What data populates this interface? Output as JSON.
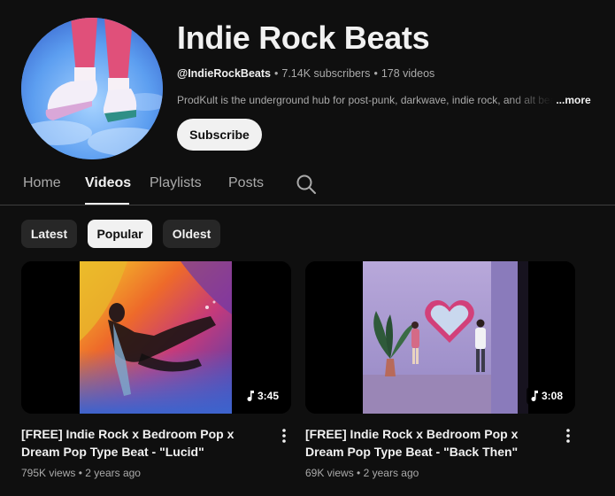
{
  "channel": {
    "title": "Indie Rock Beats",
    "handle": "@IndieRockBeats",
    "subscribers": "7.14K subscribers",
    "video_count": "178 videos",
    "description": "ProdKult is the underground hub for post-punk, darkwave, indie rock, and alt beats",
    "more_label": "...more",
    "subscribe_label": "Subscribe"
  },
  "tabs": [
    {
      "label": "Home"
    },
    {
      "label": "Videos",
      "active": true
    },
    {
      "label": "Playlists"
    },
    {
      "label": "Posts"
    }
  ],
  "filters": [
    {
      "label": "Latest"
    },
    {
      "label": "Popular",
      "active": true
    },
    {
      "label": "Oldest"
    }
  ],
  "videos": [
    {
      "title": "[FREE] Indie Rock x Bedroom Pop x Dream Pop Type Beat - \"Lucid\"",
      "duration": "3:45",
      "views": "795K views",
      "age": "2 years ago"
    },
    {
      "title": "[FREE] Indie Rock x Bedroom Pop x Dream Pop Type Beat - \"Back Then\"",
      "duration": "3:08",
      "views": "69K views",
      "age": "2 years ago"
    }
  ],
  "meta_separator": "•",
  "icons": {
    "search": "search-icon",
    "music_note": "music-note-icon",
    "more_vert": "more-vert-icon"
  },
  "colors": {
    "background": "#0f0f0f",
    "text_primary": "#f1f1f1",
    "text_secondary": "#aaaaaa",
    "chip_bg": "#272727",
    "chip_active_bg": "#f1f1f1"
  }
}
